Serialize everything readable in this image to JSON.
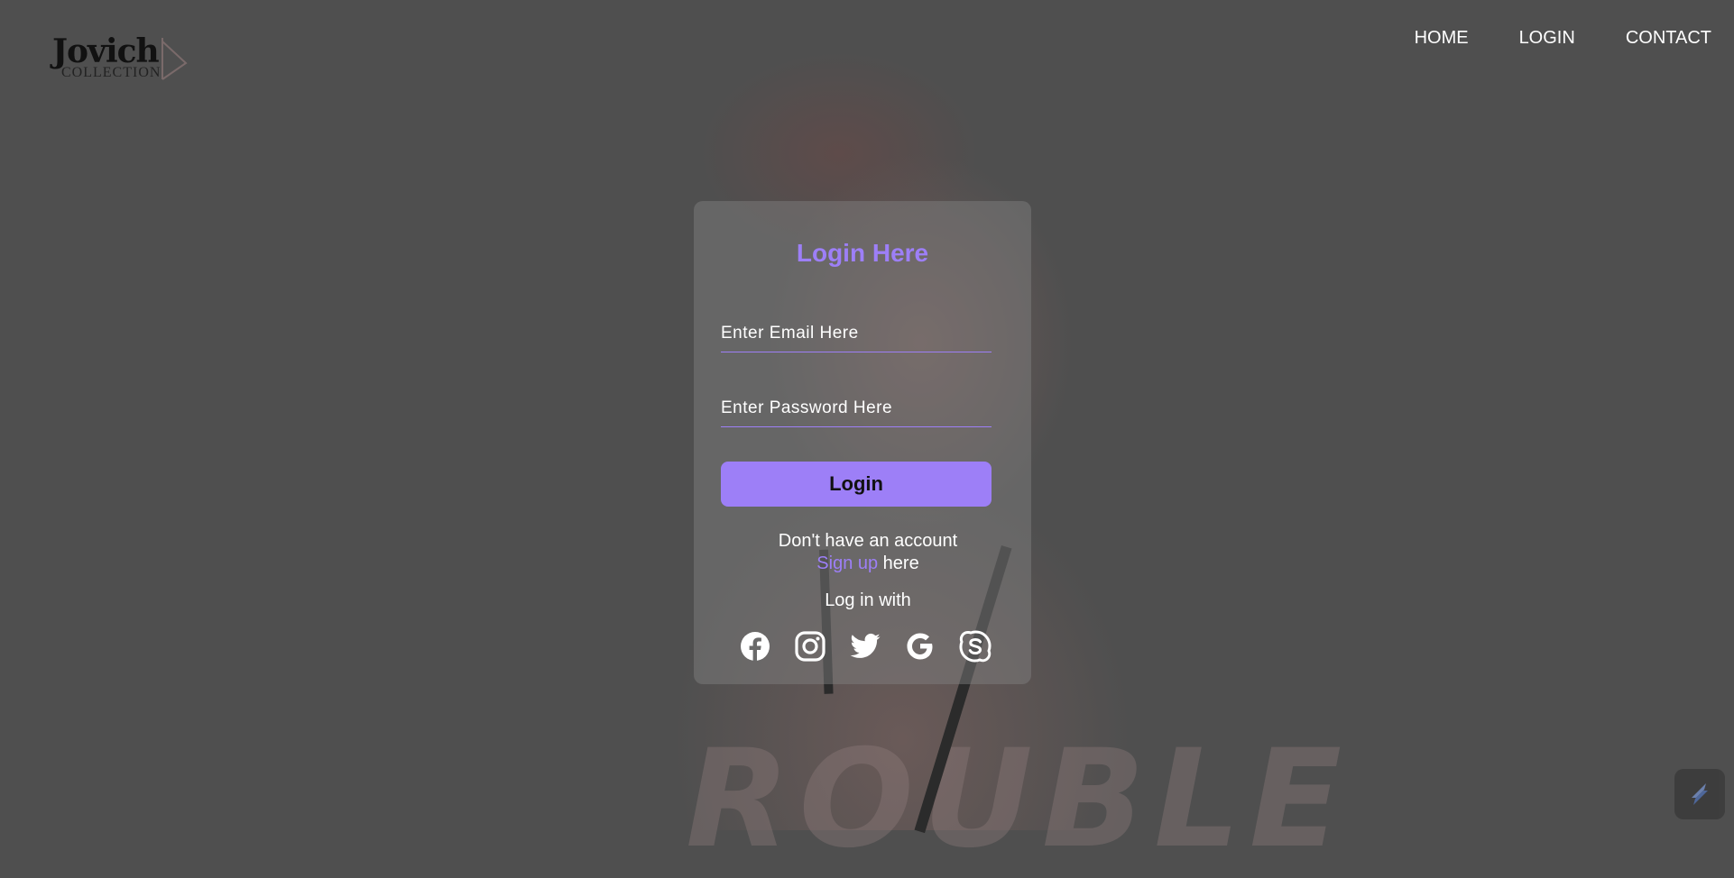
{
  "logo": {
    "name": "Jovich",
    "sub": "COLLECTION"
  },
  "nav": {
    "home": "HOME",
    "login": "LOGIN",
    "contact": "CONTACT"
  },
  "form": {
    "title": "Login Here",
    "email_placeholder": "Enter Email Here",
    "password_placeholder": "Enter Password Here",
    "login_label": "Login",
    "no_account_text": "Don't have an account",
    "signup_link": "Sign up",
    "signup_suffix": " here",
    "login_with": "Log in with"
  },
  "socials": [
    "facebook-icon",
    "instagram-icon",
    "twitter-icon",
    "google-icon",
    "skype-icon"
  ],
  "background_text": "ROUBLE",
  "colors": {
    "accent": "#9d7ff7",
    "overlay": "#4f4f4f"
  }
}
